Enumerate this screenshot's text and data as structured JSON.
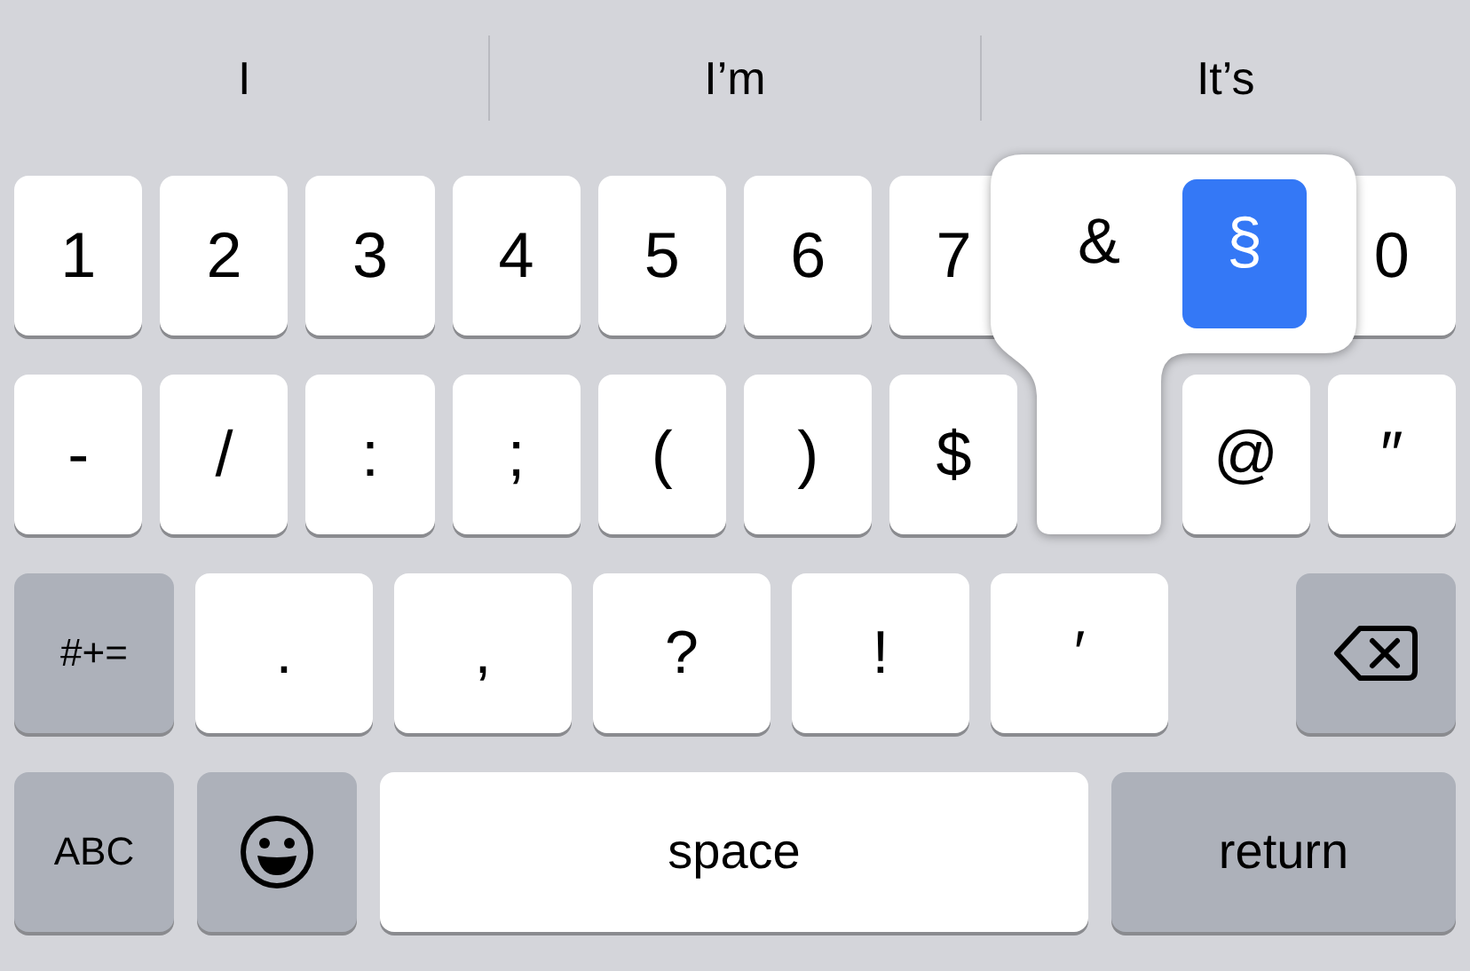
{
  "suggestions": [
    "I",
    "I’m",
    "It’s"
  ],
  "rows": [
    {
      "keys": [
        {
          "kind": "char",
          "label": "1"
        },
        {
          "kind": "char",
          "label": "2"
        },
        {
          "kind": "char",
          "label": "3"
        },
        {
          "kind": "char",
          "label": "4"
        },
        {
          "kind": "char",
          "label": "5"
        },
        {
          "kind": "char",
          "label": "6"
        },
        {
          "kind": "char",
          "label": "7"
        },
        {
          "kind": "covered"
        },
        {
          "kind": "covered"
        },
        {
          "kind": "char",
          "label": "0"
        }
      ]
    },
    {
      "keys": [
        {
          "kind": "char",
          "label": "-"
        },
        {
          "kind": "char",
          "label": "/"
        },
        {
          "kind": "char",
          "label": ":"
        },
        {
          "kind": "char",
          "label": ";"
        },
        {
          "kind": "char",
          "label": "("
        },
        {
          "kind": "char",
          "label": ")"
        },
        {
          "kind": "char",
          "label": "$"
        },
        {
          "kind": "covered"
        },
        {
          "kind": "char",
          "label": "@"
        },
        {
          "kind": "char",
          "label": "″"
        }
      ]
    },
    {
      "keys": [
        {
          "kind": "mode",
          "label": "#+="
        },
        {
          "kind": "wide",
          "label": "."
        },
        {
          "kind": "wide",
          "label": ","
        },
        {
          "kind": "wide",
          "label": "?"
        },
        {
          "kind": "wide",
          "label": "!"
        },
        {
          "kind": "wide",
          "label": "′"
        },
        {
          "kind": "delete"
        }
      ]
    },
    {
      "keys": [
        {
          "kind": "mode",
          "label": "ABC"
        },
        {
          "kind": "emoji"
        },
        {
          "kind": "space",
          "label": "space"
        },
        {
          "kind": "return",
          "label": "return"
        }
      ]
    }
  ],
  "popup": {
    "options": [
      {
        "label": "&",
        "selected": false
      },
      {
        "label": "§",
        "selected": true
      }
    ]
  }
}
